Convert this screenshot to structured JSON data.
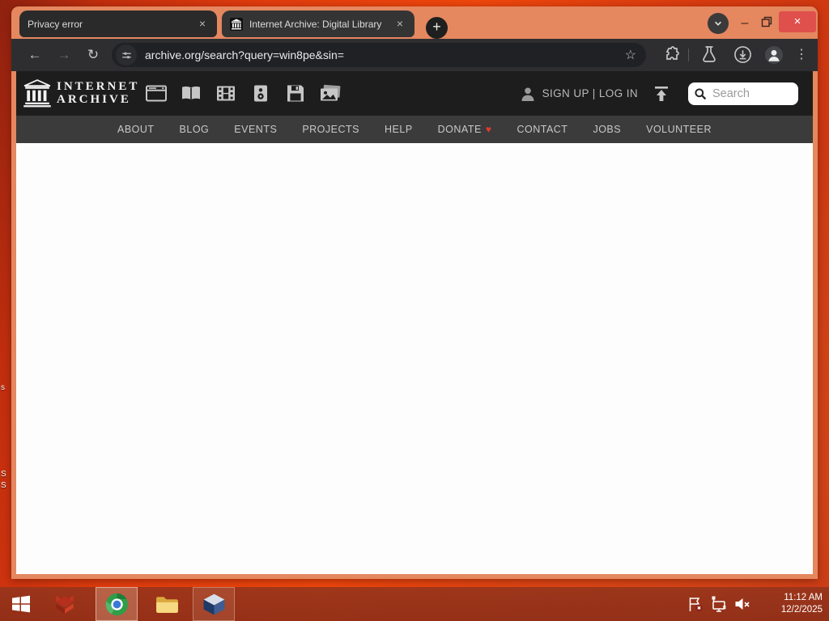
{
  "browser": {
    "tabs": [
      {
        "title": "Privacy error"
      },
      {
        "title": "Internet Archive: Digital Library"
      }
    ],
    "url": "archive.org/search?query=win8pe&sin="
  },
  "icons": {
    "back": "←",
    "forward": "→",
    "reload": "↻",
    "new_tab": "+",
    "tab_close": "×",
    "star": "☆",
    "menu_kebab": "⋮",
    "minimize": "–",
    "window_close": "×",
    "heart": "♥"
  },
  "ia": {
    "wordmark": [
      "INTERNET",
      "ARCHIVE"
    ],
    "auth": "SIGN UP | LOG IN",
    "search_placeholder": "Search",
    "nav": [
      "ABOUT",
      "BLOG",
      "EVENTS",
      "PROJECTS",
      "HELP",
      "DONATE",
      "CONTACT",
      "JOBS",
      "VOLUNTEER"
    ]
  },
  "taskbar": {
    "time": "11:12 AM",
    "date": "12/2/2025"
  },
  "desktop": {
    "label_fragments": [
      "s",
      "S",
      "S"
    ]
  },
  "colors": {
    "frame": "#e5875f",
    "desktop_red": "#d83b0e",
    "taskbar": "#94341c",
    "close_button": "#df4f4b",
    "heart": "#e0392f",
    "ia_header_bg": "#1d1d1d",
    "ia_nav_bg": "#3b3b3b"
  }
}
